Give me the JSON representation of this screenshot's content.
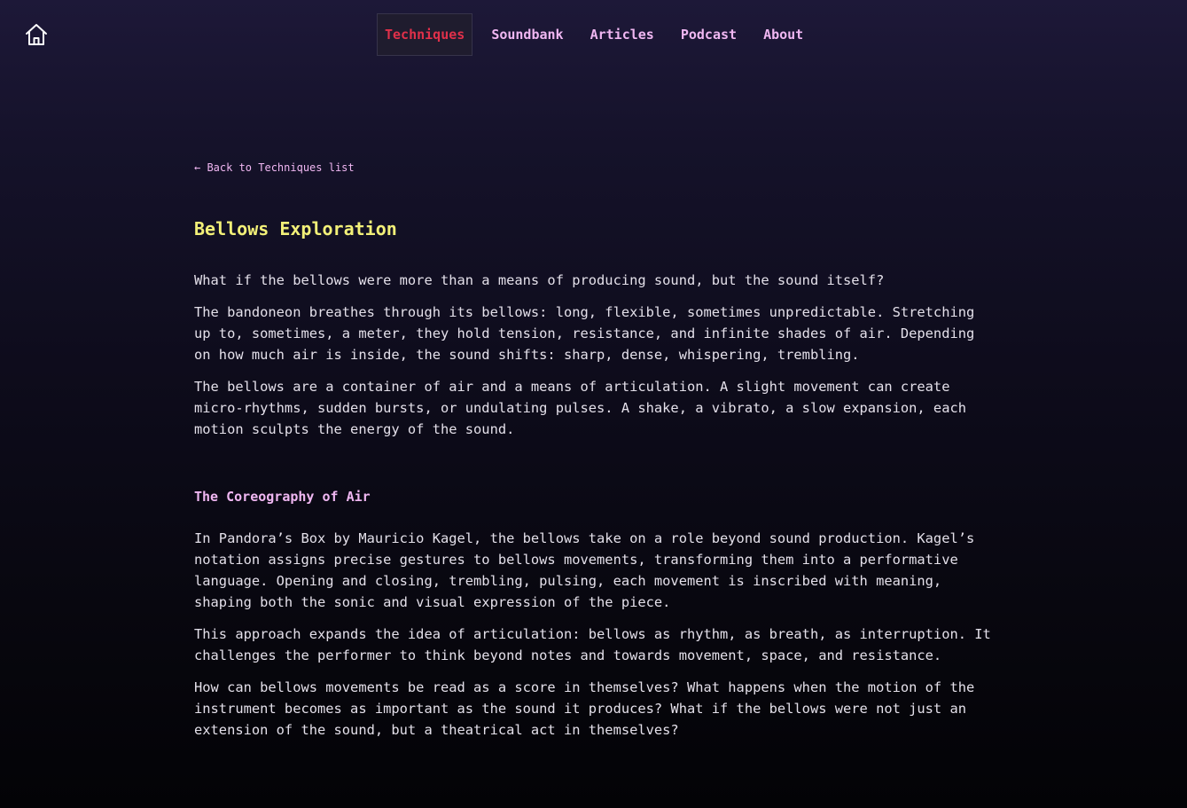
{
  "nav": {
    "home_icon": "home-icon",
    "items": [
      {
        "label": "Techniques",
        "active": true
      },
      {
        "label": "Soundbank",
        "active": false
      },
      {
        "label": "Articles",
        "active": false
      },
      {
        "label": "Podcast",
        "active": false
      },
      {
        "label": "About",
        "active": false
      }
    ]
  },
  "article": {
    "back_link": "← Back to Techniques list",
    "title": "Bellows Exploration",
    "intro_paragraphs": [
      "What if the bellows were more than a means of producing sound, but the sound itself?",
      "The bandoneon breathes through its bellows: long, flexible, sometimes unpredictable. Stretching up to, sometimes, a meter, they hold tension, resistance, and infinite shades of air. Depending on how much air is inside, the sound shifts: sharp, dense, whispering, trembling.",
      "The bellows are a container of air and a means of articulation. A slight movement can create micro-rhythms, sudden bursts, or undulating pulses. A shake, a vibrato, a slow expansion, each motion sculpts the energy of the sound."
    ],
    "section_title": "The Coreography of Air",
    "section_paragraphs": [
      "In Pandora’s Box by Mauricio Kagel, the bellows take on a role beyond sound production. Kagel’s notation assigns precise gestures to bellows movements, transforming them into a performative language. Opening and closing, trembling, pulsing, each movement is inscribed with meaning, shaping both the sonic and visual expression of the piece.",
      "This approach expands the idea of articulation: bellows as rhythm, as breath, as interruption. It challenges the performer to think beyond notes and towards movement, space, and resistance.",
      "How can bellows movements be read as a score in themselves? What happens when the motion of the instrument becomes as important as the sound it produces? What if the bellows were not just an extension of the sound, but a theatrical act in themselves?"
    ]
  },
  "colors": {
    "accent_active": "#e0304a",
    "nav_link": "#f0b7f2",
    "title": "#f2f078",
    "body_text": "#e4e0ea"
  }
}
